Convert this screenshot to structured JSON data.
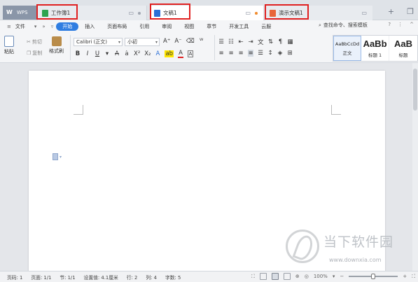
{
  "tabs": {
    "wps": "WPS",
    "items": [
      {
        "label": "工作簿1",
        "kind": "spreadsheet",
        "color": "#2ea44f"
      },
      {
        "label": "文稿1",
        "kind": "document",
        "color": "#2b6fd6"
      },
      {
        "label": "演示文稿1",
        "kind": "presentation",
        "color": "#e8663a"
      }
    ]
  },
  "menu": {
    "file": "文件",
    "items": [
      "开始",
      "插入",
      "页面布局",
      "引用",
      "审阅",
      "视图",
      "章节",
      "开发工具",
      "云服"
    ],
    "active": "开始",
    "search": "查找命令、搜索模板"
  },
  "ribbon": {
    "paste": "粘贴",
    "cut": "剪切",
    "copy": "复制",
    "format_painter": "格式刷",
    "font_name": "Calibri (正文)",
    "font_size": "小初",
    "styles": [
      {
        "preview": "AaBbCcDd",
        "label": "正文"
      },
      {
        "preview": "AaBb",
        "label": "标题 1"
      },
      {
        "preview": "AaB",
        "label": "标题"
      }
    ]
  },
  "watermark": {
    "text": "当下软件园",
    "url": "www.downxia.com"
  },
  "status": {
    "page_label": "页码: 1",
    "pages": "页面: 1/1",
    "section": "节: 1/1",
    "setting": "设置值: 4.1厘米",
    "line": "行: 2",
    "col": "列: 4",
    "chars": "字数: 5",
    "zoom": "100%"
  },
  "colors": {
    "accent": "#2f7de1",
    "highlight_box": "#e02020"
  }
}
